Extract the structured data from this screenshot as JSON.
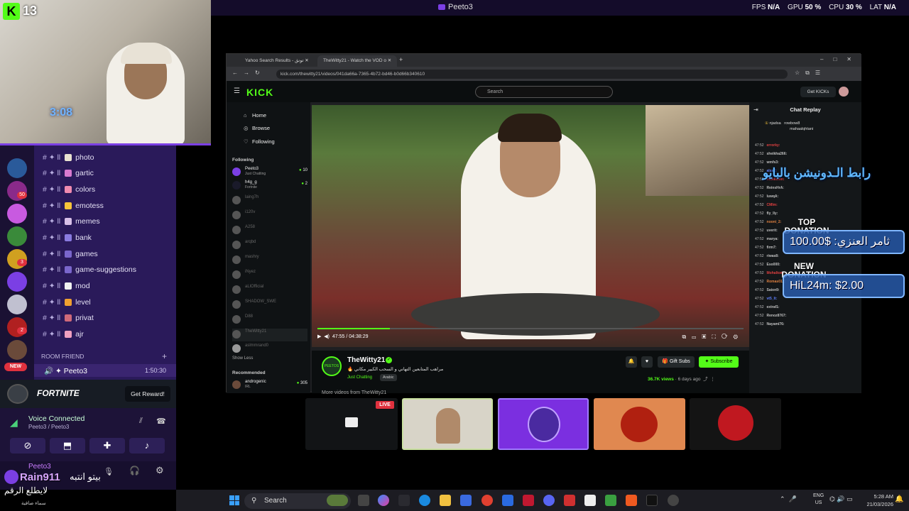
{
  "window": {
    "title": "Peeto3"
  },
  "perf": {
    "fps_label": "FPS",
    "fps_value": "N/A",
    "gpu_label": "GPU",
    "gpu_value": "50 %",
    "cpu_label": "CPU",
    "cpu_value": "30 %",
    "lat_label": "LAT",
    "lat_value": "N/A"
  },
  "webcam": {
    "kick_count": "13",
    "clock": "3:08"
  },
  "servers": {
    "badges": [
      "50",
      "3",
      "2"
    ],
    "new_label": "NEW"
  },
  "channels": [
    {
      "name": "photo",
      "color": "#e9e2d0"
    },
    {
      "name": "gartic",
      "color": "#d97ad0"
    },
    {
      "name": "colors",
      "color": "#f08bb0"
    },
    {
      "name": "emotess",
      "color": "#f7c43a"
    },
    {
      "name": "memes",
      "color": "#d8c0e8"
    },
    {
      "name": "bank",
      "color": "#8a7be0"
    },
    {
      "name": "games",
      "color": "#7a66cc"
    },
    {
      "name": "game-suggestions",
      "color": "#7a66cc"
    },
    {
      "name": "mod",
      "color": "#f0f0f0"
    },
    {
      "name": "level",
      "color": "#f0a030"
    },
    {
      "name": "privat",
      "color": "#d06a7a"
    },
    {
      "name": "ajr",
      "color": "#f0a0c0"
    }
  ],
  "room": {
    "header": "ROOM FRIEND",
    "user": "Peeto3",
    "time": "1:50:30"
  },
  "promo": {
    "name": "FORTNITE",
    "button": "Get Reward!"
  },
  "voice": {
    "title": "Voice Connected",
    "subtitle": "Peeto3 / Peeto3"
  },
  "user_panel": {
    "name": "Peeto3",
    "display": "Rain911",
    "arabic": "بيتو انتبه",
    "footer1": "لايطلع الرقم",
    "footer2": "سماء صافية"
  },
  "browser": {
    "tabs": [
      "Yahoo Search Results - تونق",
      "TheWitty21 - Watch the VOD o"
    ],
    "url": "kick.com/thewitty21/videos/041da66a-7365-4b72-bd46-b0d66b340610"
  },
  "kick": {
    "logo": "KICK",
    "search_placeholder": "Search",
    "get_kicks": "Get KICKs",
    "nav": [
      "Home",
      "Browse",
      "Following"
    ],
    "following_header": "Following",
    "following": [
      {
        "name": "Peeto3",
        "sub": "Just Chatting",
        "count": "10",
        "online": true
      },
      {
        "name": "h4g_g",
        "sub": "Fortnite",
        "count": "2",
        "online": true
      },
      {
        "name": "laing7h",
        "sub": "",
        "count": "",
        "online": false
      },
      {
        "name": "i120v",
        "sub": "",
        "count": "",
        "online": false
      },
      {
        "name": "A258",
        "sub": "",
        "count": "",
        "online": false
      },
      {
        "name": "arqbd",
        "sub": "",
        "count": "",
        "online": false
      },
      {
        "name": "mashry",
        "sub": "",
        "count": "",
        "online": false
      },
      {
        "name": "iNyez",
        "sub": "",
        "count": "",
        "online": false
      },
      {
        "name": "aLlOfficial",
        "sub": "",
        "count": "",
        "online": false
      },
      {
        "name": "SHADOW_SWE",
        "sub": "",
        "count": "",
        "online": false
      },
      {
        "name": "D88",
        "sub": "",
        "count": "",
        "online": false
      },
      {
        "name": "TheWitty21",
        "sub": "",
        "count": "",
        "online": false
      },
      {
        "name": "aslmmrand0",
        "sub": "",
        "count": "",
        "online": false
      }
    ],
    "show_less": "Show Less",
    "recommended_header": "Recommended",
    "recommended": [
      {
        "name": "androgenic",
        "sub": "IRL",
        "count": "305"
      }
    ]
  },
  "video": {
    "time": "47:55 / 04:38:29",
    "progress": 0.17
  },
  "stream": {
    "channel": "TheWitty21",
    "avatar_text": "PEETOS",
    "title": "🔥 مراهب المتابعين التهاني و السحب الكبير مكاني",
    "category": "Just Chatting",
    "language": "Arabic",
    "gift_subs": "Gift Subs",
    "subscribe": "Subscribe",
    "views": "36.7K views",
    "ago": "6 days ago",
    "more_videos": "More videos from TheWitty21"
  },
  "chat": {
    "header": "Chat Replay",
    "leaderboard": [
      "njadsa",
      "rowbow8",
      "mahaalqhtani"
    ],
    "messages": [
      {
        "time": "47:52",
        "user": "errorky:",
        "color": "#e04040"
      },
      {
        "time": "47:52",
        "user": "sheikha266:",
        "color": "#c0c0c0"
      },
      {
        "time": "47:52",
        "user": "wmfs3:",
        "color": "#c0c0c0"
      },
      {
        "time": "47:52",
        "user": "alss2:",
        "color": "#6080ff"
      },
      {
        "time": "47:52",
        "user": "mdkkxnm:",
        "color": "#e04040"
      },
      {
        "time": "47:52",
        "user": "ReinsHrA:",
        "color": "#c0c0c0"
      },
      {
        "time": "47:52",
        "user": "luwqA:",
        "color": "#c0c0c0"
      },
      {
        "time": "47:52",
        "user": "CMIm:",
        "color": "#e04040"
      },
      {
        "time": "47:52",
        "user": "fly_lly:",
        "color": "#c0c0c0"
      },
      {
        "time": "47:52",
        "user": "nooni_2:",
        "color": "#e08040"
      },
      {
        "time": "47:52",
        "user": "uverit:",
        "color": "#c0c0c0"
      },
      {
        "time": "47:52",
        "user": "marya:",
        "color": "#c0c0c0"
      },
      {
        "time": "47:52",
        "user": "firm7:",
        "color": "#c0c0c0"
      },
      {
        "time": "47:52",
        "user": "riwas8:",
        "color": "#c0c0c0"
      },
      {
        "time": "47:52",
        "user": "Eso000:",
        "color": "#c0c0c0"
      },
      {
        "time": "47:52",
        "user": "Mohaltom:",
        "color": "#e04040"
      },
      {
        "time": "47:52",
        "user": "Romas012:",
        "color": "#e08040"
      },
      {
        "time": "47:52",
        "user": "Saion9:",
        "color": "#c0c0c0"
      },
      {
        "time": "47:52",
        "user": "vt5_lt:",
        "color": "#6080ff"
      },
      {
        "time": "47:52",
        "user": "extraf1:",
        "color": "#c0c0c0"
      },
      {
        "time": "47:52",
        "user": "Renoz8767:",
        "color": "#c0c0c0"
      },
      {
        "time": "47:52",
        "user": "Nayami76:",
        "color": "#c0c0c0"
      }
    ]
  },
  "overlays": {
    "link_text": "رابط الـدونيشن بالبايو",
    "top_label_1": "TOP",
    "top_label_2": "DONATION",
    "top_value": "100.00$ :ثامر العنزي",
    "new_label_1": "NEW",
    "new_label_2": "DONATION",
    "new_value": "HiL24m: $2.00"
  },
  "thumbnails": {
    "live_label": "LIVE"
  },
  "taskbar": {
    "search_label": "Search",
    "lang": "ENG",
    "region": "US",
    "time": "5:28 AM",
    "date": "21/03/2026"
  }
}
